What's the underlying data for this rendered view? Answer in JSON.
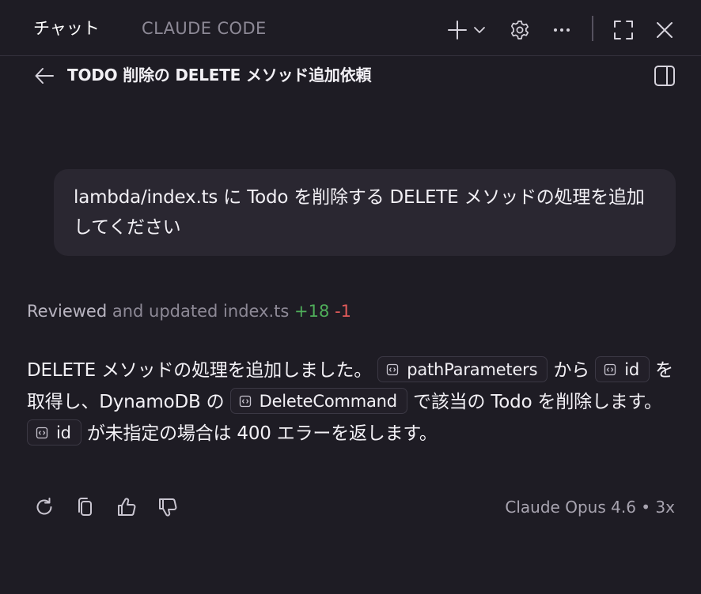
{
  "tabs": {
    "chat": "チャット",
    "claude_code": "CLAUDE CODE"
  },
  "toolbar_icons": [
    "plus-icon",
    "chevron-down-icon",
    "gear-icon",
    "more-icon",
    "fullscreen-icon",
    "close-icon"
  ],
  "header": {
    "title": "TODO 削除の DELETE メソッド追加依頼"
  },
  "user_message": {
    "text": "lambda/index.ts に Todo を削除する DELETE メソッドの処理を追加してください"
  },
  "reviewed": {
    "verb": "Reviewed",
    "rest": " and updated index.ts",
    "additions": "+18",
    "deletions": "-1"
  },
  "response": {
    "t1": "DELETE メソッドの処理を追加しました。",
    "chip1": "pathParameters",
    "t2": " から ",
    "chip2": "id",
    "t3": " を取得し、DynamoDB の ",
    "chip3": "DeleteCommand",
    "t4": " で該当の Todo を削除します。",
    "chip4": "id",
    "t5": " が未指定の場合は 400 エラーを返します。"
  },
  "footer": {
    "model": "Claude Opus 4.6 • 3x"
  },
  "colors": {
    "background": "#1e1c24",
    "bubble": "#2a2731",
    "additions": "#4fae5a",
    "deletions": "#e05a5a"
  }
}
